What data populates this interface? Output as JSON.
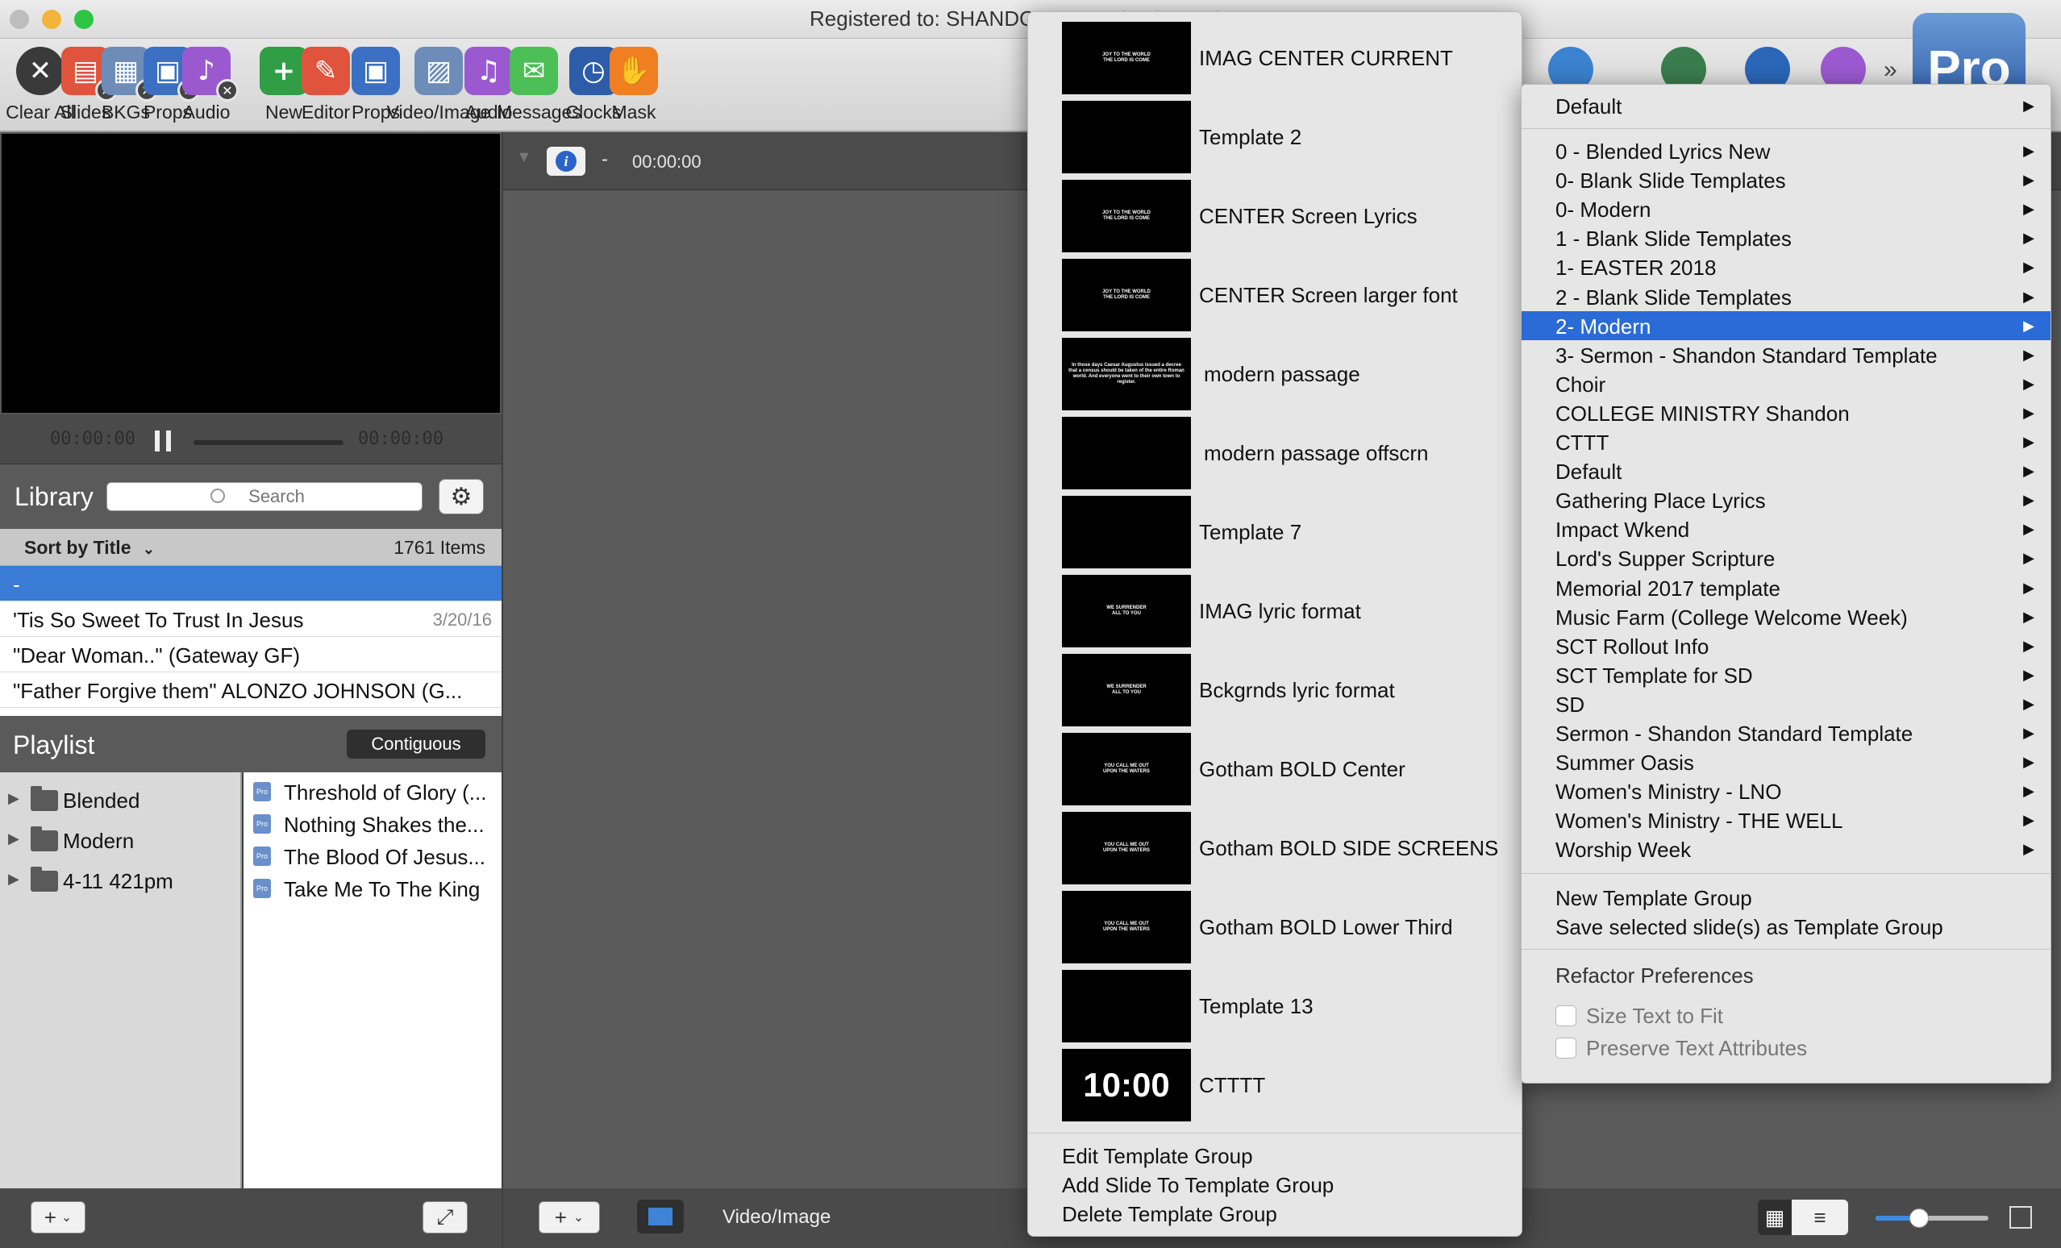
{
  "window": {
    "title": "Registered to: SHANDON BAPTIST CHURCH"
  },
  "toolbar": {
    "items": [
      {
        "label": "Clear All",
        "icon": "clear-all-icon",
        "color": "#3a3a3a"
      },
      {
        "label": "Slides",
        "icon": "slides-clear-icon",
        "color": "#e0533d"
      },
      {
        "label": "BKGs",
        "icon": "backgrounds-clear-icon",
        "color": "#6d8db8"
      },
      {
        "label": "Props",
        "icon": "props-clear-icon",
        "color": "#3b6fc4"
      },
      {
        "label": "Audio",
        "icon": "audio-clear-icon",
        "color": "#9b59d0"
      },
      {
        "label": "New",
        "icon": "new-document-icon",
        "color": "#2f9e44"
      },
      {
        "label": "Editor",
        "icon": "editor-icon",
        "color": "#e0533d"
      },
      {
        "label": "Props",
        "icon": "props-icon",
        "color": "#3b6fc4"
      },
      {
        "label": "Video/Image",
        "icon": "video-image-icon",
        "color": "#6d8db8"
      },
      {
        "label": "Audio",
        "icon": "audio-icon",
        "color": "#9b59d0"
      },
      {
        "label": "Messages",
        "icon": "messages-icon",
        "color": "#4cbf56"
      },
      {
        "label": "Clocks",
        "icon": "clock-icon",
        "color": "#2d5da8"
      },
      {
        "label": "Mask",
        "icon": "mask-icon",
        "color": "#f07f22"
      }
    ]
  },
  "preview": {
    "time_start": "00:00:00",
    "time_end": "00:00:00"
  },
  "library": {
    "title": "Library",
    "search_placeholder": "Search",
    "sort_label": "Sort by Title",
    "item_count": "1761 Items",
    "rows": [
      {
        "title": "-",
        "date": ""
      },
      {
        "title": "'Tis So Sweet To Trust In Jesus",
        "date": "3/20/16"
      },
      {
        "title": "\"Dear Woman..\"  (Gateway GF)",
        "date": ""
      },
      {
        "title": "\"Father Forgive them\" ALONZO JOHNSON (G...",
        "date": ""
      }
    ]
  },
  "playlist": {
    "title": "Playlist",
    "contiguous_label": "Contiguous",
    "folders": [
      "Blended",
      "Modern",
      "4-11 421pm"
    ],
    "items": [
      "Threshold of Glory (...",
      "Nothing Shakes the...",
      "The Blood Of Jesus...",
      "Take Me To The King"
    ]
  },
  "center": {
    "dash": "-",
    "time": "00:00:00",
    "bottom_label": "Video/Image"
  },
  "template_menu": {
    "templates": [
      {
        "name": "IMAG CENTER CURRENT",
        "thumb": "JOY TO THE WORLD\nTHE LORD IS COME"
      },
      {
        "name": "Template 2",
        "thumb": ""
      },
      {
        "name": "CENTER Screen Lyrics",
        "thumb": "JOY TO THE WORLD\nTHE LORD IS COME"
      },
      {
        "name": "CENTER Screen larger font",
        "thumb": "JOY TO THE WORLD\nTHE LORD IS COME"
      },
      {
        "name": "modern passage",
        "thumb": "In those days Caesar Augustus issued a decree that a census should be taken of the entire Roman world. And everyone went to their own town to register."
      },
      {
        "name": "modern passage offscrn",
        "thumb": ""
      },
      {
        "name": "Template 7",
        "thumb": ""
      },
      {
        "name": "IMAG lyric format",
        "thumb": "WE SURRENDER\nALL TO YOU"
      },
      {
        "name": "Bckgrnds lyric format",
        "thumb": "WE SURRENDER\nALL TO YOU"
      },
      {
        "name": "Gotham BOLD Center",
        "thumb": "YOU CALL ME OUT\nUPON THE WATERS"
      },
      {
        "name": "Gotham BOLD SIDE SCREENS",
        "thumb": "YOU CALL ME OUT\nUPON THE WATERS"
      },
      {
        "name": "Gotham BOLD Lower Third",
        "thumb": "YOU CALL ME OUT\nUPON THE WATERS"
      },
      {
        "name": "Template 13",
        "thumb": ""
      },
      {
        "name": "CTTTT",
        "thumb": "10:00"
      }
    ],
    "actions": [
      "Edit Template Group",
      "Add Slide To Template Group",
      "Delete Template Group"
    ]
  },
  "group_menu": {
    "top": "Default",
    "groups": [
      "0 - Blended Lyrics New",
      "0- Blank Slide Templates",
      "0- Modern",
      "1 - Blank Slide Templates",
      "1- EASTER 2018",
      "2 - Blank Slide Templates",
      "2- Modern",
      "3- Sermon - Shandon Standard Template",
      "Choir",
      "COLLEGE MINISTRY Shandon",
      "CTTT",
      "Default",
      "Gathering Place Lyrics",
      "Impact Wkend",
      "Lord's Supper Scripture",
      "Memorial 2017 template",
      "Music Farm (College Welcome Week)",
      "SCT Rollout Info",
      "SCT Template for SD",
      "SD",
      "Sermon - Shandon Standard Template",
      "Summer Oasis",
      "Women's Ministry - LNO",
      "Women's Ministry - THE WELL",
      "Worship Week"
    ],
    "selected_index": 6,
    "new_group": "New Template Group",
    "save_group": "Save selected slide(s) as Template Group",
    "refactor_heading": "Refactor Preferences",
    "size_text": "Size Text to Fit",
    "preserve_text": "Preserve Text Attributes"
  },
  "app_logo": "Pro"
}
